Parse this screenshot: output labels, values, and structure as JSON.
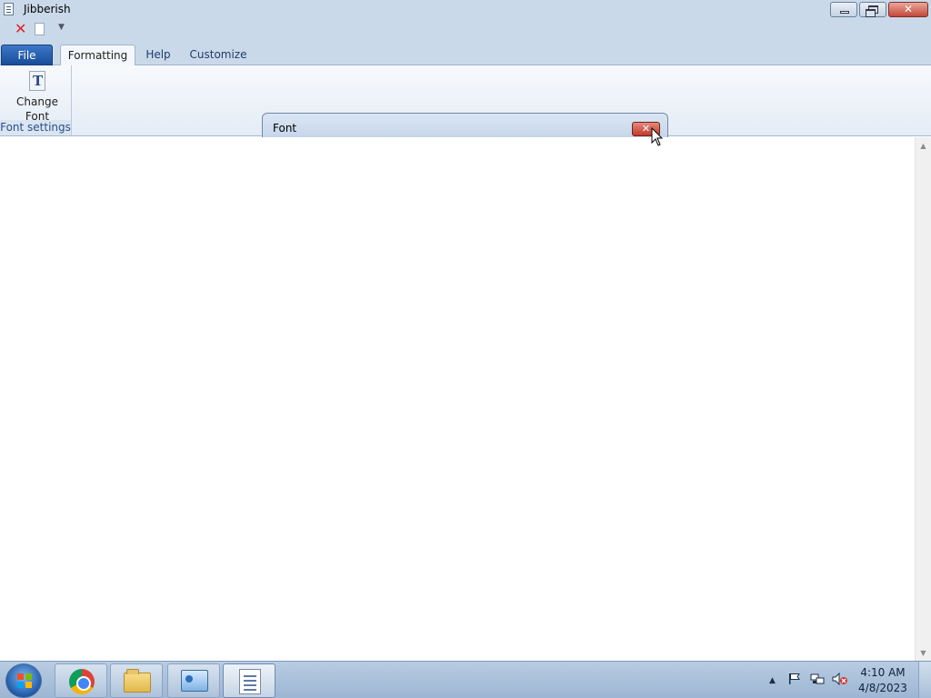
{
  "window": {
    "title": "Jibberish",
    "close_glyph": "✕"
  },
  "ribbon": {
    "tabs": [
      {
        "label": "File"
      },
      {
        "label": "Formatting"
      },
      {
        "label": "Help"
      },
      {
        "label": "Customize"
      }
    ],
    "active_tab": "Formatting",
    "groups": [
      {
        "label": "Font settings",
        "buttons": [
          {
            "line1": "Change",
            "line2": "Font",
            "icon": "font-icon"
          }
        ]
      }
    ]
  },
  "dialog": {
    "title": "Font",
    "close_glyph": "✕"
  },
  "taskbar": {
    "items": [
      {
        "name": "chrome",
        "icon": "chrome-icon"
      },
      {
        "name": "explorer",
        "icon": "folder-icon"
      },
      {
        "name": "control-panel",
        "icon": "control-panel-icon"
      },
      {
        "name": "wordpad",
        "icon": "document-icon",
        "active": true
      }
    ],
    "clock": {
      "time": "4:10 AM",
      "date": "4/8/2023"
    }
  },
  "colors": {
    "chrome_bg": "#cad9ea",
    "file_tab": "#2a62b4",
    "close_red": "#c4473a"
  }
}
